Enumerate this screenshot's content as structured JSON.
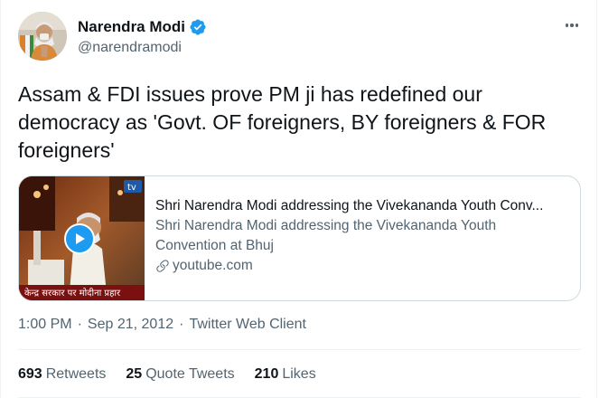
{
  "author": {
    "display_name": "Narendra Modi",
    "handle": "@narendramodi",
    "verified": true,
    "avatar_icon": "profile-photo"
  },
  "tweet": {
    "text": "Assam & FDI issues prove PM ji has redefined our democracy as 'Govt. OF foreigners, BY foreigners & FOR foreigners'"
  },
  "link_card": {
    "title": "Shri Narendra Modi addressing the Vivekananda Youth Conv...",
    "description": "Shri Narendra Modi addressing the Vivekananda Youth Convention at Bhuj",
    "domain": "youtube.com",
    "thumbnail_caption": "केन्द्र सरकार पर मोदीना प्रहार",
    "thumbnail_badge": "tv"
  },
  "meta": {
    "time": "1:00 PM",
    "date": "Sep 21, 2012",
    "separator": "·",
    "source": "Twitter Web Client"
  },
  "stats": {
    "retweets_count": "693",
    "retweets_label": "Retweets",
    "quote_count": "25",
    "quote_label": "Quote Tweets",
    "likes_count": "210",
    "likes_label": "Likes"
  },
  "colors": {
    "accent": "#1d9bf0",
    "text_primary": "#0f1419",
    "text_secondary": "#536471",
    "border": "#cfd9de"
  }
}
